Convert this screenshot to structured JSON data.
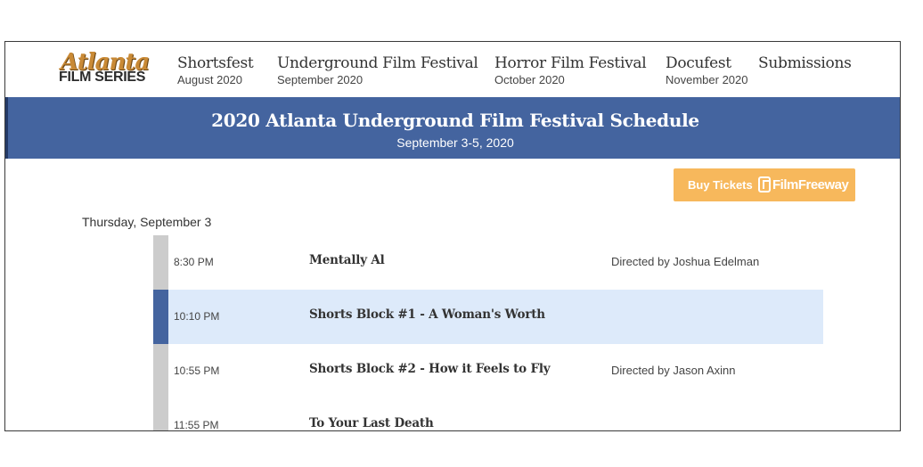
{
  "logo": {
    "line1": "Atlanta",
    "line2": "FILM SERIES"
  },
  "nav": [
    {
      "title": "Shortsfest",
      "sub": "August 2020"
    },
    {
      "title": "Underground Film Festival",
      "sub": "September 2020"
    },
    {
      "title": "Horror Film Festival",
      "sub": "October 2020"
    },
    {
      "title": "Docufest",
      "sub": "November 2020"
    },
    {
      "title": "Submissions",
      "sub": ""
    }
  ],
  "banner": {
    "title": "2020 Atlanta Underground Film Festival Schedule",
    "dates": "September 3-5, 2020"
  },
  "buy": {
    "label": "Buy Tickets",
    "brand": "FilmFreeway"
  },
  "schedule": {
    "day": "Thursday, September 3",
    "rows": [
      {
        "time": "8:30 PM",
        "title": "Mentally Al",
        "director": "Directed by Joshua Edelman",
        "active": false
      },
      {
        "time": "10:10 PM",
        "title": "Shorts Block #1 - A Woman's Worth",
        "director": "",
        "active": true
      },
      {
        "time": "10:55 PM",
        "title": "Shorts Block #2 - How it Feels to Fly",
        "director": "Directed by Jason Axinn",
        "active": false
      },
      {
        "time": "11:55 PM",
        "title": "To Your Last Death",
        "director": "",
        "active": false
      }
    ]
  },
  "colors": {
    "banner": "#44649f",
    "active_row": "#ddeafa",
    "buy_button": "#f7b85c",
    "rail": "#cccccc"
  }
}
